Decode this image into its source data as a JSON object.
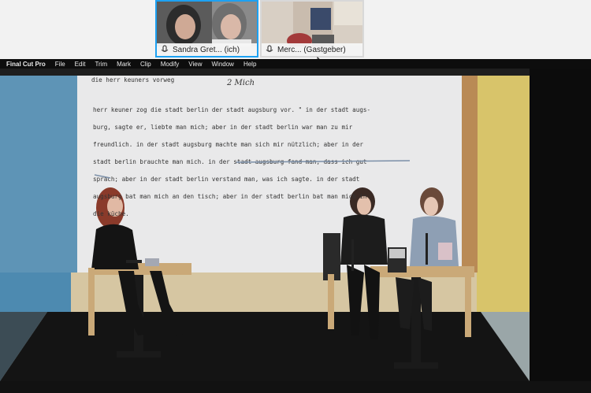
{
  "participants": [
    {
      "name": "Sandra Gret...",
      "tag": "(ich)",
      "active": true
    },
    {
      "name": "Merc...",
      "tag": "(Gastgeber)",
      "active": false
    }
  ],
  "menubar": {
    "app": "Final Cut Pro",
    "items": [
      "File",
      "Edit",
      "Trim",
      "Mark",
      "Clip",
      "Modify",
      "View",
      "Window",
      "Help"
    ]
  },
  "projection": {
    "header_left": "die herr keuners vorweg",
    "header_right": "2 Mich",
    "lines": [
      "herr keuner zog die stadt berlin der stadt augsburg vor. \" in der stadt augs-",
      "burg, sagte er, liebte man mich; aber in der stadt berlin war man zu mir",
      "freundlich. in der stadt augsburg machte man sich mir nützlich; aber in der",
      "stadt berlin brauchte man mich. in der stadt augsburg fand man, dass ich gut",
      "sprach; aber in der stadt berlin verstand man, was ich sagte. in der stadt",
      "augsburg bat man mich an den tisch; aber in der stadt berlin bat man mich in",
      "die küche."
    ]
  },
  "colors": {
    "active_border": "#1da1f2",
    "wall_blue": "#4d8ab0",
    "wall_yellow": "#d8c46a",
    "stage": "#141414"
  },
  "icons": [
    "microphone-icon",
    "microphone-icon",
    "cursor-icon"
  ]
}
